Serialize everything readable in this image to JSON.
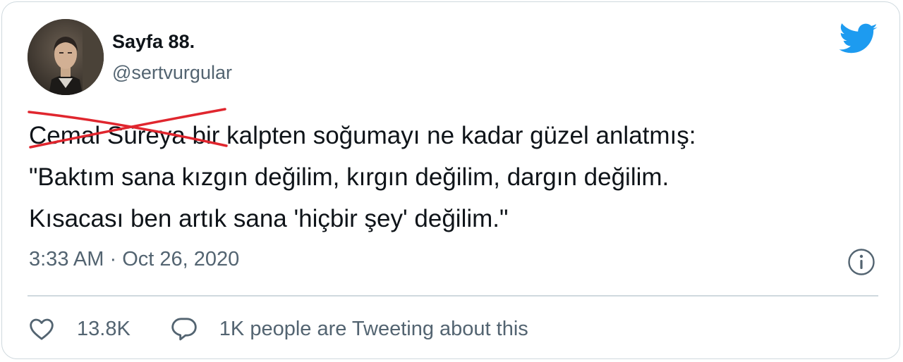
{
  "tweet": {
    "author": {
      "display_name": "Sayfa 88.",
      "handle": "@sertvurgular",
      "avatar": "profile-photo"
    },
    "text": {
      "struck_name": "Cemal Süreya",
      "line1_rest": " bir kalpten soğumayı ne kadar güzel anlatmış:",
      "line2": "\"Baktım sana kızgın değilim, kırgın değilim, dargın değilim.",
      "line3": "Kısacası ben artık sana 'hiçbir şey' değilim.\""
    },
    "timestamp": {
      "time": "3:33 AM",
      "separator": "·",
      "date": "Oct 26, 2020"
    },
    "actions": {
      "likes_count": "13.8K",
      "conversation_label": "1K people are Tweeting about this"
    },
    "icons": {
      "brand": "twitter-bird-icon",
      "info": "info-icon",
      "like": "heart-icon",
      "reply": "speech-bubble-icon"
    },
    "colors": {
      "twitter_blue": "#1d9bf0",
      "strike_red": "#e0262e",
      "text_primary": "#0f1419",
      "text_secondary": "#536471",
      "border": "#cfd9de"
    }
  }
}
